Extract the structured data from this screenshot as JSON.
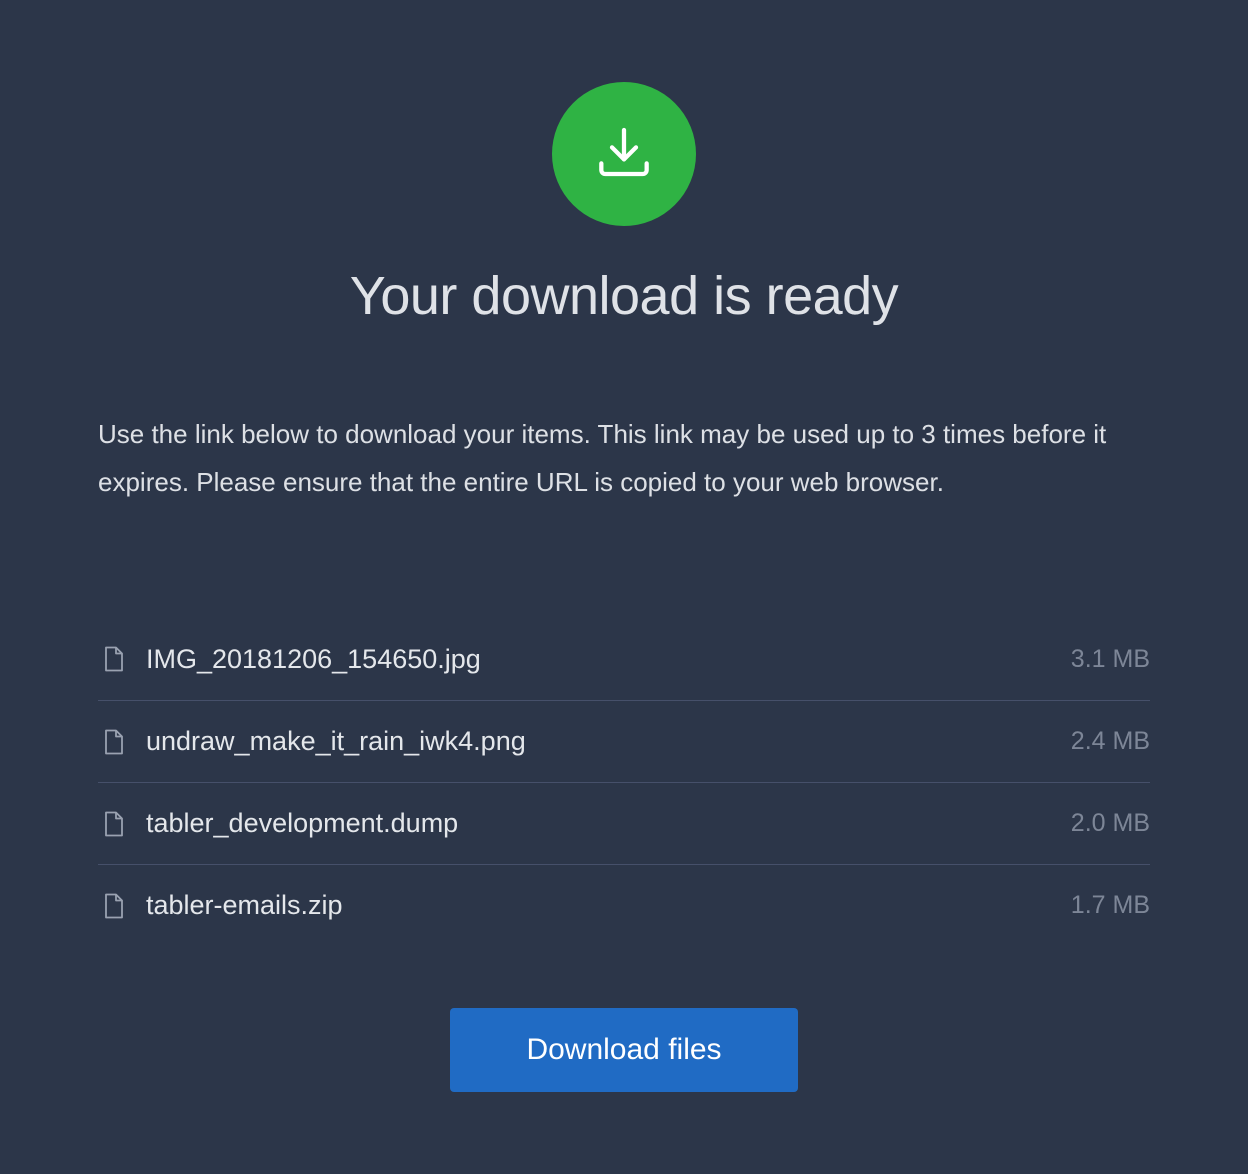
{
  "header": {
    "icon": "download-icon",
    "icon_bg_color": "#2fb344",
    "title": "Your download is ready"
  },
  "description": "Use the link below to download your items. This link may be used up to 3 times before it expires. Please ensure that the entire URL is copied to your web browser.",
  "files": [
    {
      "icon": "file-icon",
      "name": "IMG_20181206_154650.jpg",
      "size": "3.1 MB"
    },
    {
      "icon": "file-icon",
      "name": "undraw_make_it_rain_iwk4.png",
      "size": "2.4 MB"
    },
    {
      "icon": "file-icon",
      "name": "tabler_development.dump",
      "size": "2.0 MB"
    },
    {
      "icon": "file-icon",
      "name": "tabler-emails.zip",
      "size": "1.7 MB"
    }
  ],
  "action": {
    "button_label": "Download files",
    "button_color": "#206bc4"
  },
  "colors": {
    "background": "#2c3649",
    "divider": "#46506a",
    "muted_text": "#7d8697"
  }
}
